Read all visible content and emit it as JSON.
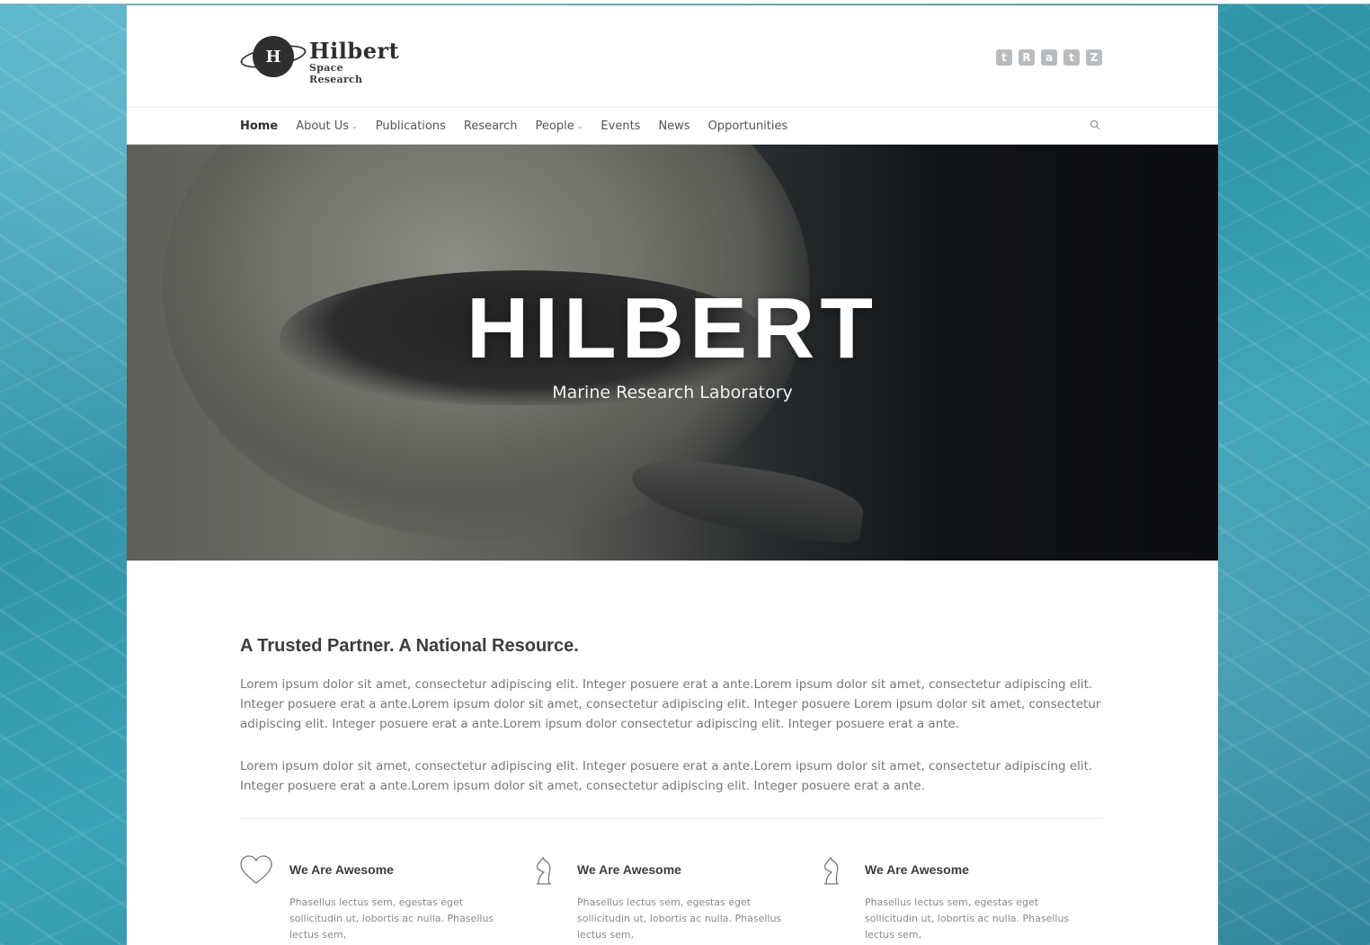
{
  "brand": {
    "name": "Hilbert",
    "tagline": "Space Research",
    "logo_letter": "H"
  },
  "social": [
    {
      "icon": "twitter-icon",
      "glyph": "t"
    },
    {
      "icon": "researchgate-icon",
      "glyph": "R"
    },
    {
      "icon": "academia-icon",
      "glyph": "a"
    },
    {
      "icon": "twitter-icon",
      "glyph": "t"
    },
    {
      "icon": "zotero-icon",
      "glyph": "Z"
    }
  ],
  "nav": {
    "items": [
      {
        "label": "Home",
        "active": true
      },
      {
        "label": "About Us",
        "dropdown": true
      },
      {
        "label": "Publications"
      },
      {
        "label": "Research"
      },
      {
        "label": "People",
        "dropdown": true
      },
      {
        "label": "Events"
      },
      {
        "label": "News"
      },
      {
        "label": "Opportunities"
      }
    ]
  },
  "hero": {
    "title": "HILBERT",
    "subtitle": "Marine Research Laboratory"
  },
  "intro": {
    "heading": "A Trusted Partner. A National Resource.",
    "paragraph1": "Lorem ipsum dolor sit amet, consectetur adipiscing elit. Integer posuere erat a ante.Lorem ipsum dolor sit amet, consectetur adipiscing elit. Integer posuere erat a ante.Lorem ipsum dolor sit amet, consectetur adipiscing elit. Integer posuere Lorem ipsum dolor sit amet, consectetur adipiscing elit. Integer posuere erat a ante.Lorem ipsum dolor consectetur adipiscing elit. Integer posuere erat a ante.",
    "paragraph2": "Lorem ipsum dolor sit amet, consectetur adipiscing elit. Integer posuere erat a ante.Lorem ipsum dolor sit amet, consectetur adipiscing elit. Integer posuere erat a ante.Lorem ipsum dolor sit amet, consectetur adipiscing elit. Integer posuere erat a ante."
  },
  "features": [
    {
      "icon": "heart-icon",
      "title": "We Are Awesome",
      "text": "Phasellus lectus sem, egestas eget sollicitudin ut, lobortis ac nulla. Phasellus lectus sem,"
    },
    {
      "icon": "chess-knight-icon",
      "title": "We Are Awesome",
      "text": "Phasellus lectus sem, egestas eget sollicitudin ut, lobortis ac nulla. Phasellus lectus sem,"
    },
    {
      "icon": "chess-knight-icon",
      "title": "We Are Awesome",
      "text": "Phasellus lectus sem, egestas eget sollicitudin ut, lobortis ac nulla. Phasellus lectus sem,"
    }
  ]
}
